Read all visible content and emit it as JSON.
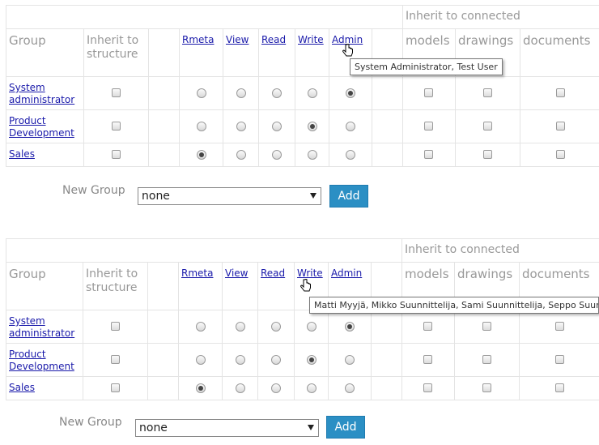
{
  "columns": {
    "group": "Group",
    "inherit_structure": "Inherit to structure",
    "rmeta": "Rmeta",
    "view": "View",
    "read": "Read",
    "write": "Write",
    "admin": "Admin",
    "inherit_connected": "Inherit to connected",
    "models": "models",
    "drawings": "drawings",
    "documents": "documents"
  },
  "panels": [
    {
      "rows": [
        {
          "group": "System administrator",
          "selected": "admin"
        },
        {
          "group": "Product Development",
          "selected": "write"
        },
        {
          "group": "Sales",
          "selected": "rmeta"
        }
      ],
      "new_group_label": "New Group",
      "new_group_value": "none",
      "add_label": "Add",
      "tooltip": "System Administrator, Test User"
    },
    {
      "rows": [
        {
          "group": "System administrator",
          "selected": "admin"
        },
        {
          "group": "Product Development",
          "selected": "write"
        },
        {
          "group": "Sales",
          "selected": "rmeta"
        }
      ],
      "new_group_label": "New Group",
      "new_group_value": "none",
      "add_label": "Add",
      "tooltip": "Matti Myyjä, Mikko Suunnittelija, Sami Suunnittelija, Seppo Suunnittelija"
    }
  ]
}
